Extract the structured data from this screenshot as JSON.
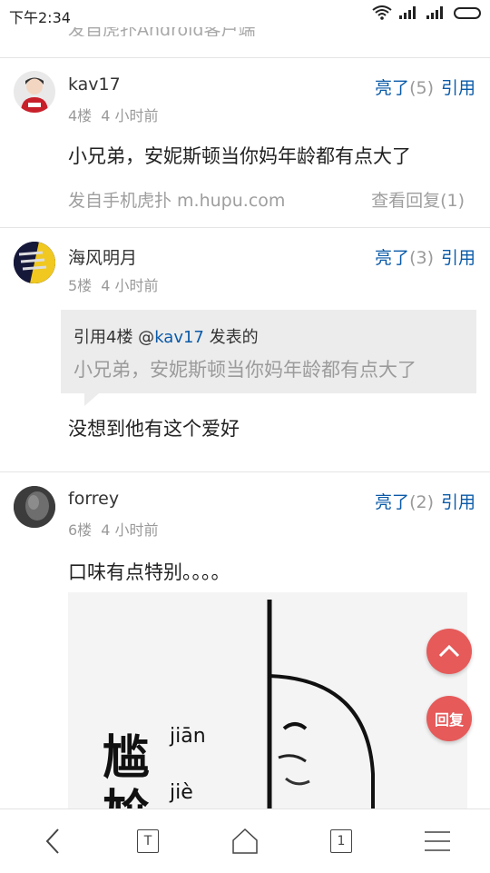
{
  "status": {
    "time": "下午2:34"
  },
  "partial_top": "发自虎扑Android客户端",
  "posts": [
    {
      "author": "kav17",
      "floor": "4楼",
      "time": "4 小时前",
      "light_label": "亮了",
      "light_count": "(5)",
      "quote_label": "引用",
      "content": "小兄弟，安妮斯顿当你妈年龄都有点大了",
      "source": "发自手机虎扑 m.hupu.com",
      "replies": "查看回复(1)"
    },
    {
      "author": "海风明月",
      "floor": "5楼",
      "time": "4 小时前",
      "light_label": "亮了",
      "light_count": "(3)",
      "quote_label": "引用",
      "quote": {
        "prefix": "引用4楼 @",
        "name": "kav17",
        "suffix": " 发表的",
        "text": "小兄弟，安妮斯顿当你妈年龄都有点大了"
      },
      "content": "没想到他有这个爱好"
    },
    {
      "author": "forrey",
      "floor": "6楼",
      "time": "4 小时前",
      "light_label": "亮了",
      "light_count": "(2)",
      "quote_label": "引用",
      "content": "口味有点特别。。。。",
      "meme": {
        "char1": "尴",
        "pinyin1": "jiān",
        "char2": "尬",
        "pinyin2": "jiè"
      }
    }
  ],
  "fab": {
    "reply_label": "回复"
  },
  "nav": {
    "tab_count": "1",
    "text_icon_letter": "T"
  }
}
